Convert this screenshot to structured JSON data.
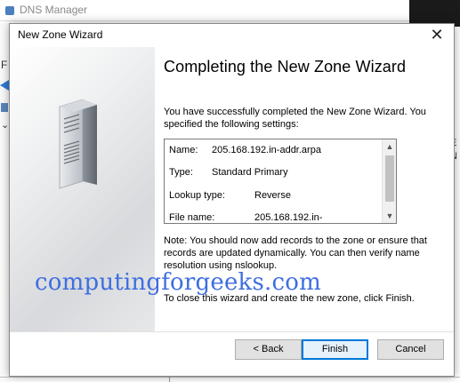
{
  "background": {
    "window_title": "DNS Manager",
    "left_letter": "F",
    "right_letter_1": "E",
    "right_letter_2": "N"
  },
  "dialog": {
    "title": "New Zone Wizard",
    "close_glyph": "✕",
    "heading": "Completing the New Zone Wizard",
    "intro": "You have successfully completed the New Zone Wizard. You specified the following settings:",
    "settings": [
      {
        "label": "Name:",
        "value": "205.168.192.in-addr.arpa"
      },
      {
        "label": "Type:",
        "value": "Standard Primary"
      },
      {
        "label": "Lookup type:",
        "value": "Reverse"
      },
      {
        "label": "File name:",
        "value": "205.168.192.in-"
      }
    ],
    "scroll_up_glyph": "▲",
    "scroll_down_glyph": "▼",
    "note": "Note: You should now add records to the zone or ensure that records are updated dynamically. You can then verify name resolution using nslookup.",
    "finish_text": "To close this wizard and create the new zone, click Finish.",
    "buttons": {
      "back": "< Back",
      "finish": "Finish",
      "cancel": "Cancel"
    }
  },
  "watermark": "computingforgeeks.com",
  "colors": {
    "accent": "#0078d7",
    "watermark": "#3d6ee0"
  },
  "icons": {
    "side_panel": "server-tower-icon"
  }
}
